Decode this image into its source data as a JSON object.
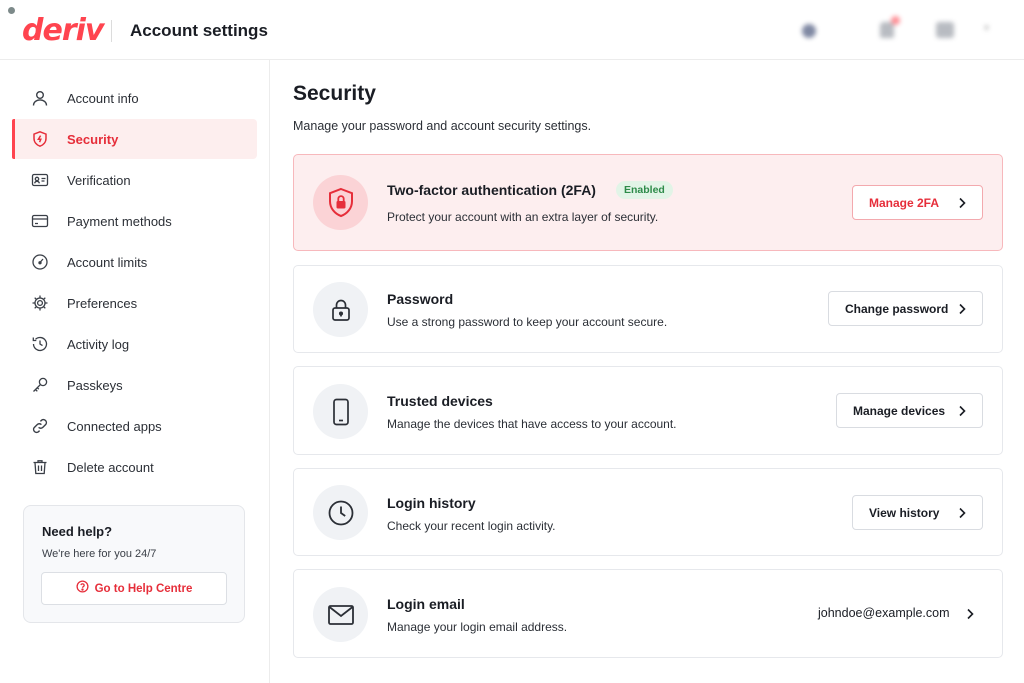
{
  "header": {
    "logo": "deriv",
    "title": "Account settings"
  },
  "sidebar": {
    "items": [
      {
        "label": "Account info",
        "icon": "user-icon"
      },
      {
        "label": "Security",
        "icon": "shield-icon",
        "active": true
      },
      {
        "label": "Verification",
        "icon": "id-card-icon"
      },
      {
        "label": "Payment methods",
        "icon": "card-icon"
      },
      {
        "label": "Account limits",
        "icon": "gauge-icon"
      },
      {
        "label": "Preferences",
        "icon": "gear-icon"
      },
      {
        "label": "Activity log",
        "icon": "history-icon"
      },
      {
        "label": "Passkeys",
        "icon": "key-icon"
      },
      {
        "label": "Connected apps",
        "icon": "link-icon"
      },
      {
        "label": "Delete account",
        "icon": "trash-icon"
      }
    ],
    "help": {
      "title": "Need help?",
      "subtitle": "We're here for you 24/7",
      "button": "Go to Help Centre"
    }
  },
  "main": {
    "title": "Security",
    "subtitle": "Manage your password and account security settings.",
    "cards": [
      {
        "title": "Two-factor authentication (2FA)",
        "badge": "Enabled",
        "desc": "Protect your account with an extra layer of security.",
        "button": "Manage 2FA",
        "icon": "shield-lock-icon"
      },
      {
        "title": "Password",
        "desc": "Use a strong password to keep your account secure.",
        "button": "Change password",
        "icon": "lock-icon"
      },
      {
        "title": "Trusted devices",
        "desc": "Manage the devices that have access to your account.",
        "button": "Manage devices",
        "icon": "phone-icon"
      },
      {
        "title": "Login history",
        "desc": "Check your recent login activity.",
        "button": "View history",
        "icon": "clock-icon"
      },
      {
        "title": "Login email",
        "desc": "Manage your login email address.",
        "value": "johndoe@example.com",
        "icon": "mail-icon"
      }
    ]
  },
  "colors": {
    "brand": "#ff444f",
    "active_bg": "#fdeeee",
    "enabled_badge": "#2e8b4a"
  }
}
